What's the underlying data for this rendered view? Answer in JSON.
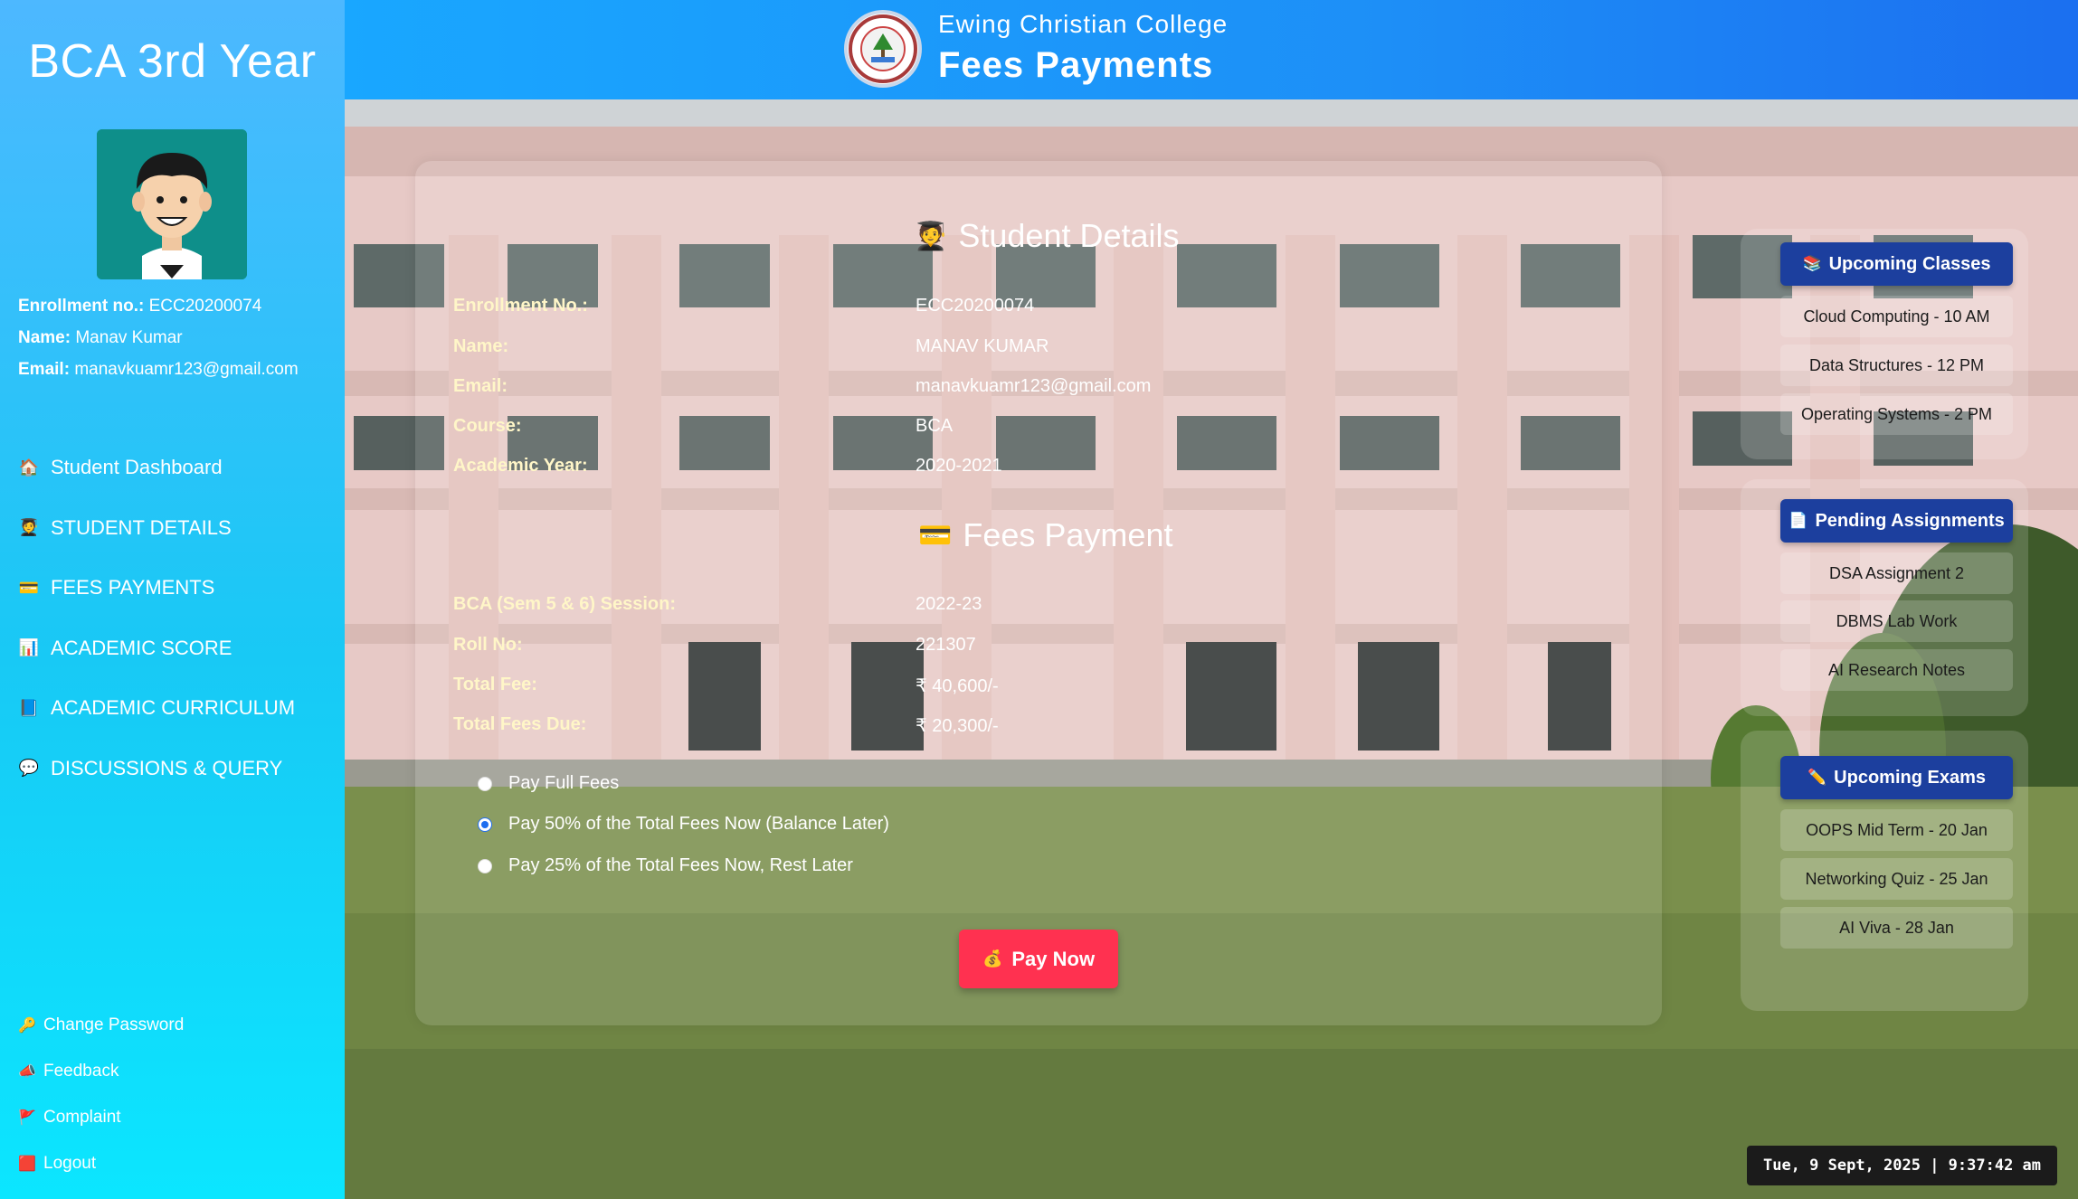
{
  "sidebar": {
    "title": "BCA 3rd Year",
    "info": {
      "enrollment_label": "Enrollment no.:",
      "enrollment_value": "ECC20200074",
      "name_label": "Name:",
      "name_value": "Manav Kumar",
      "email_label": "Email:",
      "email_value": "manavkuamr123@gmail.com"
    },
    "nav": [
      {
        "label": "Student Dashboard",
        "icon": "house-icon"
      },
      {
        "label": "STUDENT DETAILS",
        "icon": "student-icon"
      },
      {
        "label": "FEES PAYMENTS",
        "icon": "credit-card-icon"
      },
      {
        "label": "ACADEMIC SCORE",
        "icon": "bar-chart-icon"
      },
      {
        "label": "ACADEMIC CURRICULUM",
        "icon": "book-icon"
      },
      {
        "label": "DISCUSSIONS & QUERY",
        "icon": "speech-bubble-icon"
      }
    ],
    "bottom": [
      {
        "label": "Change Password",
        "icon": "key-icon"
      },
      {
        "label": "Feedback",
        "icon": "megaphone-icon"
      },
      {
        "label": "Complaint",
        "icon": "flag-icon"
      },
      {
        "label": "Logout",
        "icon": "logout-icon"
      }
    ]
  },
  "header": {
    "college": "Ewing Christian College",
    "title": "Fees Payments"
  },
  "student_details": {
    "title": "Student Details",
    "rows": [
      {
        "label": "Enrollment No.:",
        "value": "ECC20200074"
      },
      {
        "label": "Name:",
        "value": "MANAV KUMAR"
      },
      {
        "label": "Email:",
        "value": "manavkuamr123@gmail.com"
      },
      {
        "label": "Course:",
        "value": "BCA"
      },
      {
        "label": "Academic Year:",
        "value": "2020-2021"
      }
    ]
  },
  "fees_payment": {
    "title": "Fees Payment",
    "rows": [
      {
        "label": "BCA (Sem 5 & 6) Session:",
        "value": "2022-23"
      },
      {
        "label": "Roll No:",
        "value": "221307"
      },
      {
        "label": "Total Fee:",
        "value": "₹ 40,600/-"
      },
      {
        "label": "Total Fees Due:",
        "value": "₹ 20,300/-"
      }
    ],
    "options": [
      {
        "label": "Pay Full Fees",
        "checked": false
      },
      {
        "label": "Pay 50% of the Total Fees Now (Balance Later)",
        "checked": true
      },
      {
        "label": "Pay 25% of the Total Fees Now, Rest Later",
        "checked": false
      }
    ],
    "pay_button": "Pay Now"
  },
  "right_panel": {
    "upcoming_classes": {
      "title": "Upcoming Classes",
      "items": [
        "Cloud Computing - 10 AM",
        "Data Structures - 12 PM",
        "Operating Systems - 2 PM"
      ]
    },
    "pending_assignments": {
      "title": "Pending Assignments",
      "items": [
        "DSA Assignment 2",
        "DBMS Lab Work",
        "AI Research Notes"
      ]
    },
    "upcoming_exams": {
      "title": "Upcoming Exams",
      "items": [
        "OOPS Mid Term - 20 Jan",
        "Networking Quiz - 25 Jan",
        "AI Viva - 28 Jan"
      ]
    }
  },
  "datetime": "Tue, 9 Sept, 2025 | 9:37:42 am",
  "colors": {
    "sidebar_top": "#4db8ff",
    "sidebar_bottom": "#0be6ff",
    "header": "#1d8ff7",
    "panel_head": "#1c3f9e",
    "pay_button": "#ff3150"
  }
}
